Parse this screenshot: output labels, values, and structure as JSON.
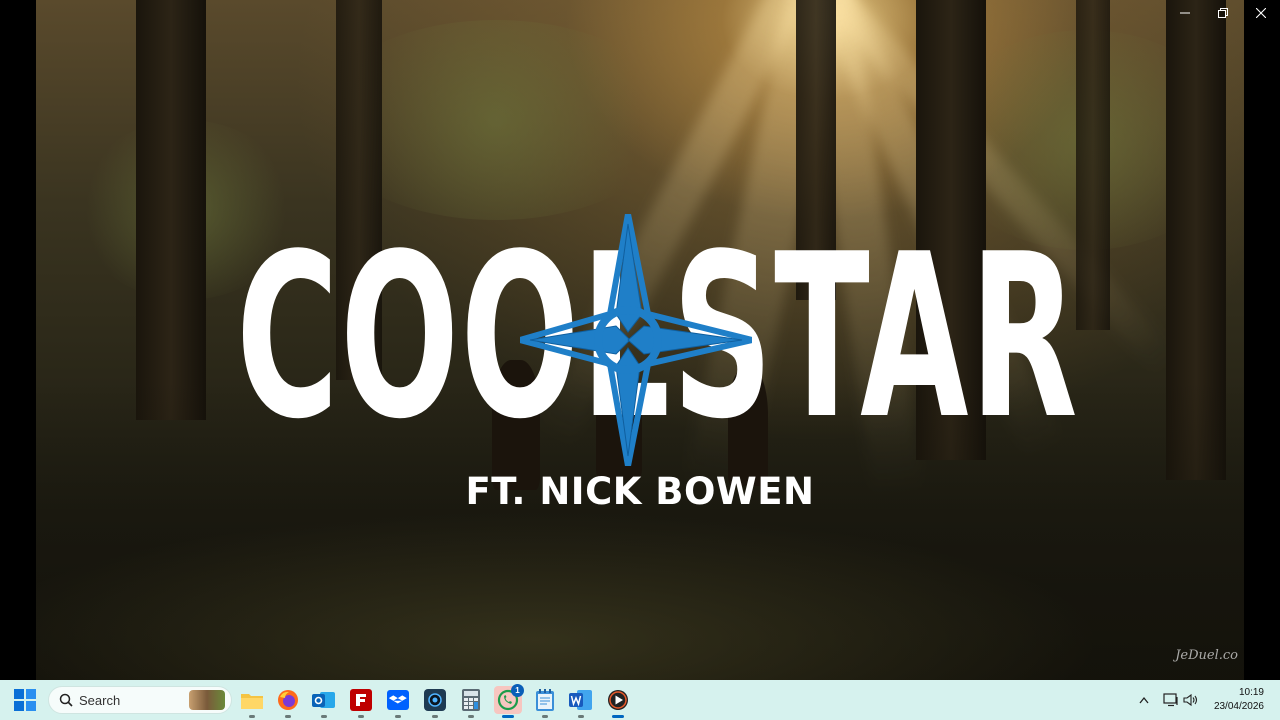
{
  "window": {
    "minimize_icon": "minimize-icon",
    "maximize_icon": "restore-icon",
    "close_icon": "close-icon"
  },
  "video": {
    "logo_text_left": "COOL",
    "logo_text_right": "STAR",
    "logo_star_icon": "compass-star-icon",
    "logo_star_color": "#1f7fc8",
    "subtitle": "FT. NICK BOWEN",
    "signature": "JeDuel.co"
  },
  "taskbar": {
    "search_placeholder": "Search",
    "apps": [
      {
        "name": "file-explorer",
        "icon": "folder-icon"
      },
      {
        "name": "firefox",
        "icon": "firefox-icon"
      },
      {
        "name": "outlook",
        "icon": "outlook-icon"
      },
      {
        "name": "filezilla",
        "icon": "filezilla-icon"
      },
      {
        "name": "dropbox",
        "icon": "dropbox-icon"
      },
      {
        "name": "camera",
        "icon": "camera-icon"
      },
      {
        "name": "calculator",
        "icon": "calculator-icon"
      },
      {
        "name": "whatsapp",
        "icon": "whatsapp-icon",
        "badge": "1"
      },
      {
        "name": "notepad",
        "icon": "notepad-icon"
      },
      {
        "name": "word",
        "icon": "word-icon"
      },
      {
        "name": "media-player",
        "icon": "media-player-icon"
      }
    ],
    "time": "10:19",
    "date": "23/04/2026"
  },
  "colors": {
    "taskbar_bg": "#d6f2ee",
    "accent": "#0067c0"
  }
}
